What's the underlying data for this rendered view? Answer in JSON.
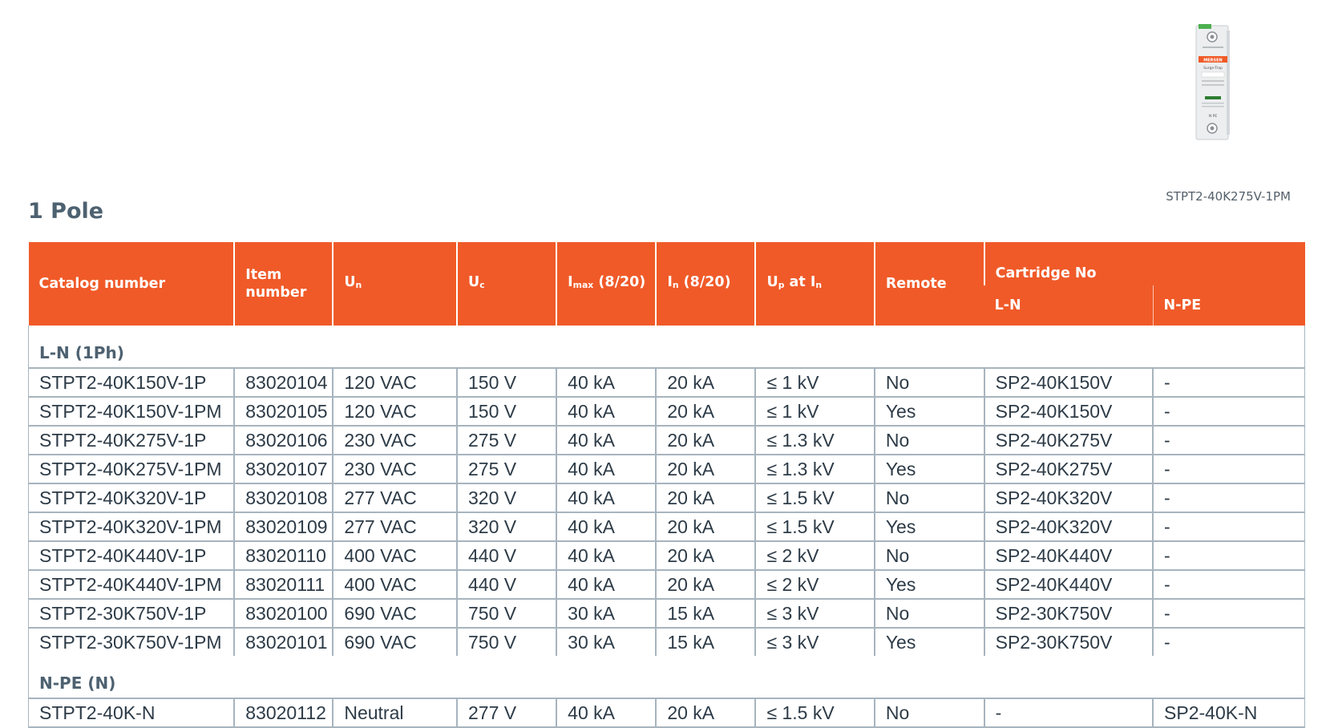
{
  "product": {
    "caption": "STPT2-40K275V-1PM",
    "device_brand": "MERSEN",
    "device_model": "Surge-Trap",
    "device_mark": "N PE"
  },
  "section_title": "1 Pole",
  "table": {
    "headers": {
      "catalog": "Catalog number",
      "item": "Item number",
      "un_main": "U",
      "un_sub": "n",
      "uc_main": "U",
      "uc_sub": "c",
      "imax_main": "I",
      "imax_sub": "max",
      "imax_suffix": " (8/20)",
      "in_main": "I",
      "in_sub": "n",
      "in_suffix": " (8/20)",
      "up_main": "U",
      "up_sub": "p",
      "up_mid": " at I",
      "up_sub2": "n",
      "remote": "Remote",
      "cartridge": "Cartridge No",
      "cartridge_ln": "L-N",
      "cartridge_npe": "N-PE"
    },
    "groups": [
      {
        "label": "L-N (1Ph)",
        "rows": [
          [
            "STPT2-40K150V-1P",
            "83020104",
            "120 VAC",
            "150 V",
            "40 kA",
            "20 kA",
            "≤ 1 kV",
            "No",
            "SP2-40K150V",
            "-"
          ],
          [
            "STPT2-40K150V-1PM",
            "83020105",
            "120 VAC",
            "150 V",
            "40 kA",
            "20 kA",
            "≤ 1 kV",
            "Yes",
            "SP2-40K150V",
            "-"
          ],
          [
            "STPT2-40K275V-1P",
            "83020106",
            "230 VAC",
            "275 V",
            "40 kA",
            "20 kA",
            "≤ 1.3 kV",
            "No",
            "SP2-40K275V",
            "-"
          ],
          [
            "STPT2-40K275V-1PM",
            "83020107",
            "230 VAC",
            "275 V",
            "40 kA",
            "20 kA",
            "≤ 1.3 kV",
            "Yes",
            "SP2-40K275V",
            "-"
          ],
          [
            "STPT2-40K320V-1P",
            "83020108",
            "277 VAC",
            "320 V",
            "40 kA",
            "20 kA",
            "≤ 1.5 kV",
            "No",
            "SP2-40K320V",
            "-"
          ],
          [
            "STPT2-40K320V-1PM",
            "83020109",
            "277 VAC",
            "320 V",
            "40 kA",
            "20 kA",
            "≤ 1.5 kV",
            "Yes",
            "SP2-40K320V",
            "-"
          ],
          [
            "STPT2-40K440V-1P",
            "83020110",
            "400 VAC",
            "440 V",
            "40 kA",
            "20 kA",
            "≤ 2 kV",
            "No",
            "SP2-40K440V",
            "-"
          ],
          [
            "STPT2-40K440V-1PM",
            "83020111",
            "400 VAC",
            "440 V",
            "40 kA",
            "20 kA",
            "≤ 2 kV",
            "Yes",
            "SP2-40K440V",
            "-"
          ],
          [
            "STPT2-30K750V-1P",
            "83020100",
            "690 VAC",
            "750 V",
            "30 kA",
            "15 kA",
            "≤ 3 kV",
            "No",
            "SP2-30K750V",
            "-"
          ],
          [
            "STPT2-30K750V-1PM",
            "83020101",
            "690 VAC",
            "750 V",
            "30 kA",
            "15 kA",
            "≤ 3 kV",
            "Yes",
            "SP2-30K750V",
            "-"
          ]
        ]
      },
      {
        "label": "N-PE (N)",
        "rows": [
          [
            "STPT2-40K-N",
            "83020112",
            "Neutral",
            "277 V",
            "40 kA",
            "20 kA",
            "≤ 1.5 kV",
            "No",
            "-",
            "SP2-40K-N"
          ]
        ]
      }
    ]
  },
  "colors": {
    "header_bg": "#f05a28",
    "border": "#a7b4be",
    "title": "#4d6170"
  }
}
